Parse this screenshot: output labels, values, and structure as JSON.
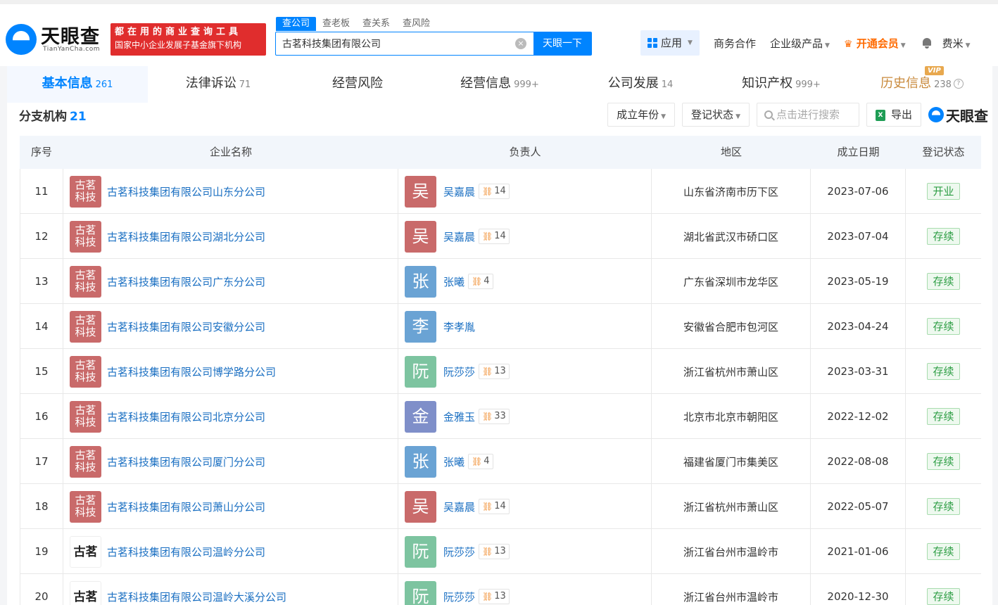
{
  "header": {
    "logo_text": "天眼查",
    "logo_sub": "TianYanCha.com",
    "slogan_line1": "都在用的商业查询工具",
    "slogan_line2": "国家中小企业发展子基金旗下机构",
    "search_tabs": [
      "查公司",
      "查老板",
      "查关系",
      "查风险"
    ],
    "search_value": "古茗科技集团有限公司",
    "search_button": "天眼一下",
    "nav": {
      "app": "应用",
      "business": "商务合作",
      "enterprise": "企业级产品",
      "vip": "开通会员",
      "user": "费米"
    }
  },
  "tabs": [
    {
      "label": "基本信息",
      "count": "261"
    },
    {
      "label": "法律诉讼",
      "count": "71"
    },
    {
      "label": "经营风险",
      "count": ""
    },
    {
      "label": "经营信息",
      "count": "999+"
    },
    {
      "label": "公司发展",
      "count": "14"
    },
    {
      "label": "知识产权",
      "count": "999+"
    },
    {
      "label": "历史信息",
      "count": "238"
    }
  ],
  "vip_tag": "VIP",
  "section": {
    "title": "分支机构",
    "count": "21",
    "filter_year": "成立年份",
    "filter_status": "登记状态",
    "search_placeholder": "点击进行搜索",
    "export": "导出",
    "logo": "天眼查"
  },
  "table": {
    "headers": [
      "序号",
      "企业名称",
      "负责人",
      "地区",
      "成立日期",
      "登记状态"
    ],
    "rows": [
      {
        "no": "11",
        "logo": "古茗科技",
        "name": "古茗科技集团有限公司山东分公司",
        "avatar": "吴",
        "avatar_color": "#c96a6a",
        "person": "吴嘉晨",
        "count": "14",
        "region": "山东省济南市历下区",
        "date": "2023-07-06",
        "status": "开业"
      },
      {
        "no": "12",
        "logo": "古茗科技",
        "name": "古茗科技集团有限公司湖北分公司",
        "avatar": "吴",
        "avatar_color": "#c96a6a",
        "person": "吴嘉晨",
        "count": "14",
        "region": "湖北省武汉市硚口区",
        "date": "2023-07-04",
        "status": "存续"
      },
      {
        "no": "13",
        "logo": "古茗科技",
        "name": "古茗科技集团有限公司广东分公司",
        "avatar": "张",
        "avatar_color": "#6aa3d4",
        "person": "张曦",
        "count": "4",
        "region": "广东省深圳市龙华区",
        "date": "2023-05-19",
        "status": "存续"
      },
      {
        "no": "14",
        "logo": "古茗科技",
        "name": "古茗科技集团有限公司安徽分公司",
        "avatar": "李",
        "avatar_color": "#6aa3d4",
        "person": "李孝胤",
        "count": "",
        "region": "安徽省合肥市包河区",
        "date": "2023-04-24",
        "status": "存续"
      },
      {
        "no": "15",
        "logo": "古茗科技",
        "name": "古茗科技集团有限公司博学路分公司",
        "avatar": "阮",
        "avatar_color": "#7dc4a0",
        "person": "阮莎莎",
        "count": "13",
        "region": "浙江省杭州市萧山区",
        "date": "2023-03-31",
        "status": "存续"
      },
      {
        "no": "16",
        "logo": "古茗科技",
        "name": "古茗科技集团有限公司北京分公司",
        "avatar": "金",
        "avatar_color": "#7f8fc9",
        "person": "金雅玉",
        "count": "33",
        "region": "北京市北京市朝阳区",
        "date": "2022-12-02",
        "status": "存续"
      },
      {
        "no": "17",
        "logo": "古茗科技",
        "name": "古茗科技集团有限公司厦门分公司",
        "avatar": "张",
        "avatar_color": "#6aa3d4",
        "person": "张曦",
        "count": "4",
        "region": "福建省厦门市集美区",
        "date": "2022-08-08",
        "status": "存续"
      },
      {
        "no": "18",
        "logo": "古茗科技",
        "name": "古茗科技集团有限公司萧山分公司",
        "avatar": "吴",
        "avatar_color": "#c96a6a",
        "person": "吴嘉晨",
        "count": "14",
        "region": "浙江省杭州市萧山区",
        "date": "2022-05-07",
        "status": "存续"
      },
      {
        "no": "19",
        "logo": "古茗",
        "name": "古茗科技集团有限公司温岭分公司",
        "avatar": "阮",
        "avatar_color": "#7dc4a0",
        "person": "阮莎莎",
        "count": "13",
        "region": "浙江省台州市温岭市",
        "date": "2021-01-06",
        "status": "存续"
      },
      {
        "no": "20",
        "logo": "古茗",
        "name": "古茗科技集团有限公司温岭大溪分公司",
        "avatar": "阮",
        "avatar_color": "#7dc4a0",
        "person": "阮莎莎",
        "count": "13",
        "region": "浙江省台州市温岭市",
        "date": "2020-12-30",
        "status": "存续"
      }
    ]
  }
}
